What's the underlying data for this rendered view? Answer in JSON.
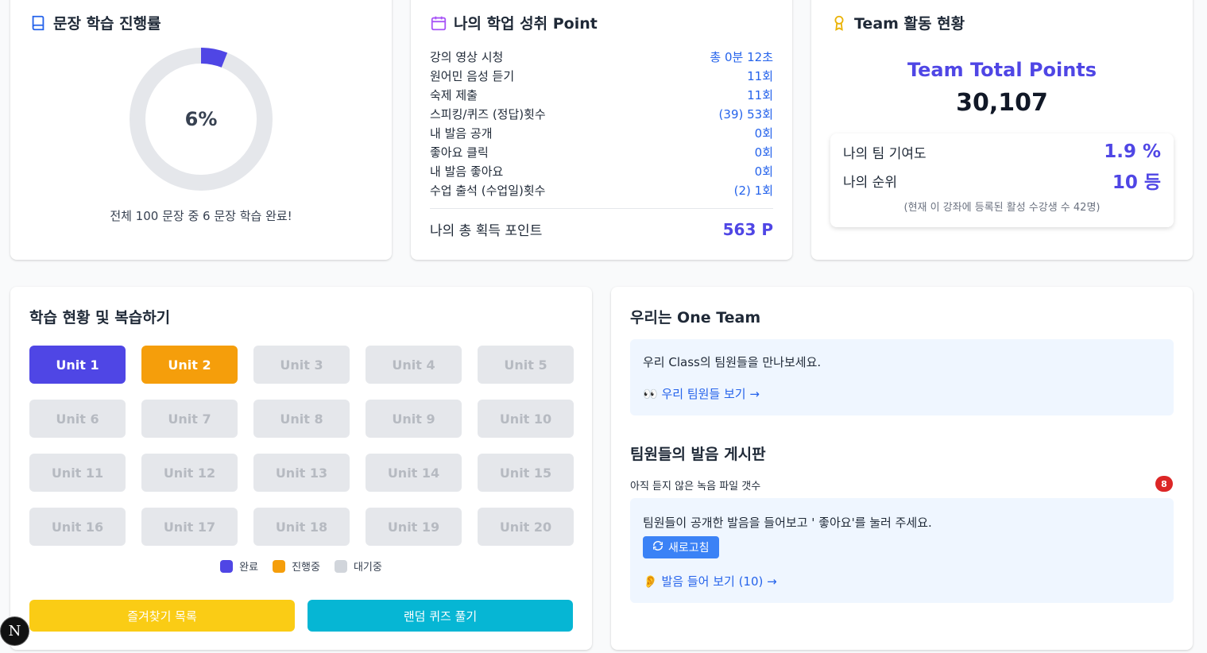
{
  "progress_card": {
    "title": "문장 학습 진행률",
    "percent_label": "6%",
    "percent": 6,
    "caption": "전체 100 문장 중 6 문장 학습 완료!",
    "colors": {
      "track": "#e5e7eb",
      "fill": "#4f46e5"
    }
  },
  "points_card": {
    "title": "나의 학업 성취 Point",
    "rows": [
      {
        "label": "강의 영상 시청",
        "value": "총 0분 12초"
      },
      {
        "label": "원어민 음성 듣기",
        "value": "11회"
      },
      {
        "label": "숙제 제출",
        "value": "11회"
      },
      {
        "label": "스피킹/퀴즈 (정답)횟수",
        "value": "(39) 53회"
      },
      {
        "label": "내 발음 공개",
        "value": "0회"
      },
      {
        "label": "좋아요 클릭",
        "value": "0회"
      },
      {
        "label": "내 발음 좋아요",
        "value": "0회"
      },
      {
        "label": "수업 출석 (수업일)횟수",
        "value": "(2) 1회"
      }
    ],
    "total_label": "나의 총 획득 포인트",
    "total_value": "563 P"
  },
  "team_card": {
    "title": "Team 활동 현황",
    "total_label": "Team Total Points",
    "total_value": "30,107",
    "contribution_label": "나의 팀 기여도",
    "contribution_value": "1.9 %",
    "rank_label": "나의 순위",
    "rank_value": "10 등",
    "note": "(현재 이 강좌에 등록된 활성 수강생 수 42명)"
  },
  "study_card": {
    "title": "학습 현황 및 복습하기",
    "units": [
      {
        "label": "Unit 1",
        "status": "done"
      },
      {
        "label": "Unit 2",
        "status": "progress"
      },
      {
        "label": "Unit 3",
        "status": "waiting"
      },
      {
        "label": "Unit 4",
        "status": "waiting"
      },
      {
        "label": "Unit 5",
        "status": "waiting"
      },
      {
        "label": "Unit 6",
        "status": "waiting"
      },
      {
        "label": "Unit 7",
        "status": "waiting"
      },
      {
        "label": "Unit 8",
        "status": "waiting"
      },
      {
        "label": "Unit 9",
        "status": "waiting"
      },
      {
        "label": "Unit 10",
        "status": "waiting"
      },
      {
        "label": "Unit 11",
        "status": "waiting"
      },
      {
        "label": "Unit 12",
        "status": "waiting"
      },
      {
        "label": "Unit 13",
        "status": "waiting"
      },
      {
        "label": "Unit 14",
        "status": "waiting"
      },
      {
        "label": "Unit 15",
        "status": "waiting"
      },
      {
        "label": "Unit 16",
        "status": "waiting"
      },
      {
        "label": "Unit 17",
        "status": "waiting"
      },
      {
        "label": "Unit 18",
        "status": "waiting"
      },
      {
        "label": "Unit 19",
        "status": "waiting"
      },
      {
        "label": "Unit 20",
        "status": "waiting"
      }
    ],
    "legend": {
      "done": "완료",
      "progress": "진행중",
      "waiting": "대기중"
    },
    "legend_colors": {
      "done": "#4f46e5",
      "progress": "#f59e0b",
      "waiting": "#d1d5db"
    },
    "favorites_button": "즐겨찾기 목록",
    "quiz_button": "랜덤 퀴즈 풀기"
  },
  "team_board_card": {
    "title": "우리는 One Team",
    "intro_text": "우리 Class의 팀원들을 만나보세요.",
    "members_link": "우리 팀원들 보기 →",
    "board_title": "팀원들의 발음 게시판",
    "unheard_label": "아직 듣지 않은 녹음 파일 갯수",
    "unheard_count": "8",
    "board_text": "팀원들이 공개한 발음을 들어보고 ' 좋아요'를 눌러 주세요.",
    "refresh_button": "새로고침",
    "listen_link": "발음 들어 보기 (10) →"
  },
  "dev_badge": "N"
}
